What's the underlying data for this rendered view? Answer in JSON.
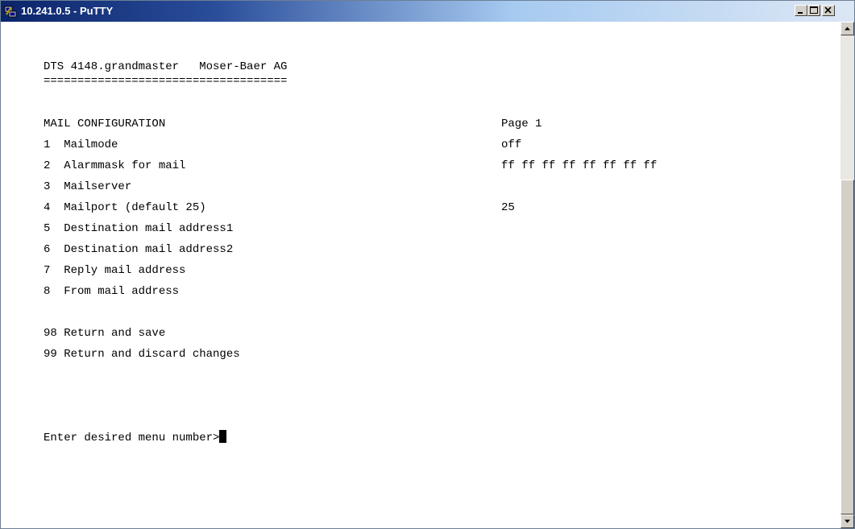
{
  "window": {
    "title": "10.241.0.5 - PuTTY",
    "app_icon": "putty-icon"
  },
  "terminal": {
    "header": "DTS 4148.grandmaster   Moser-Baer AG",
    "separator": "====================================",
    "menu_title": "MAIL CONFIGURATION",
    "page_label": "Page 1",
    "items": [
      {
        "label": "1  Mailmode",
        "value": "off"
      },
      {
        "label": "2  Alarmmask for mail",
        "value": "ff ff ff ff ff ff ff ff"
      },
      {
        "label": "3  Mailserver",
        "value": ""
      },
      {
        "label": "4  Mailport (default 25)",
        "value": "25"
      },
      {
        "label": "5  Destination mail address1",
        "value": ""
      },
      {
        "label": "6  Destination mail address2",
        "value": ""
      },
      {
        "label": "7  Reply mail address",
        "value": ""
      },
      {
        "label": "8  From mail address",
        "value": ""
      }
    ],
    "actions": [
      {
        "label": "98 Return and save"
      },
      {
        "label": "99 Return and discard changes"
      }
    ],
    "prompt": "Enter desired menu number>"
  },
  "colors": {
    "title_gradient_start": "#0a246a",
    "title_gradient_end": "#dce7f5",
    "terminal_bg": "#ffffff",
    "terminal_fg": "#000000"
  }
}
